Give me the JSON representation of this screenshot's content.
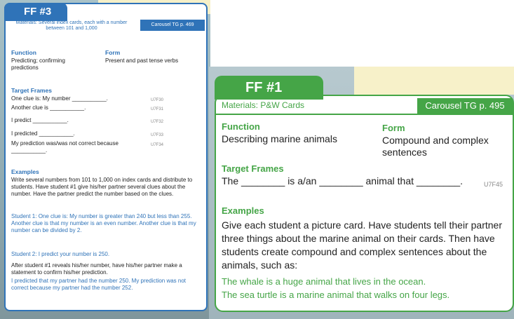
{
  "card_left": {
    "tab": "FF #3",
    "materials": "Materials: Several index cards, each with a number between 101 and 1,000",
    "ref": "Carousel TG p. 469",
    "function_heading": "Function",
    "function_text": "Predicting; confirming predictions",
    "form_heading": "Form",
    "form_text": "Present and past tense verbs",
    "frames_heading": "Target Frames",
    "frames": [
      {
        "text": "One clue is: My number ___________.",
        "code": "U7F30"
      },
      {
        "text": "Another clue is ___________.",
        "code": "U7F31"
      },
      {
        "text": "I predict ___________.",
        "code": "U7F32"
      },
      {
        "text": "I predicted ___________.",
        "code": "U7F33"
      },
      {
        "text": "My prediction was/was not correct because ___________.",
        "code": "U7F34"
      }
    ],
    "examples_heading": "Examples",
    "examples_intro": "Write several numbers from 101 to 1,000 on index cards and distribute to students. Have student #1 give his/her partner several clues about the number. Have the partner predict the number based on the clues.",
    "student1_line": "Student 1: One clue is: My number is greater than 240 but less than 255. Another clue is that my number is an even number. Another clue is that my number can be divided by 2.",
    "student2_line": "Student 2: I predict your number is 250.",
    "after_text": "After student #1 reveals his/her number, have his/her partner make a statement to confirm his/her prediction.",
    "after_example": "I predicted that my partner had the number 250. My prediction was not correct because my partner had the number 252."
  },
  "card_right": {
    "tab": "FF #1",
    "materials": "Materials: P&W Cards",
    "ref": "Carousel TG p. 495",
    "function_heading": "Function",
    "function_text": "Describing marine animals",
    "form_heading": "Form",
    "form_text": "Compound and complex sentences",
    "frames_heading": "Target Frames",
    "frame_text": "The ________ is a/an ________ animal that ________.",
    "frame_code": "U7F45",
    "examples_heading": "Examples",
    "examples_text": "Give each student a picture card. Have students tell their partner three things about the marine animal on their cards. Then have students create compound and complex sentences about the animals, such as:",
    "example1": "The whale is a huge animal that lives in the ocean.",
    "example2": "The sea turtle is a marine animal that walks on four legs."
  }
}
